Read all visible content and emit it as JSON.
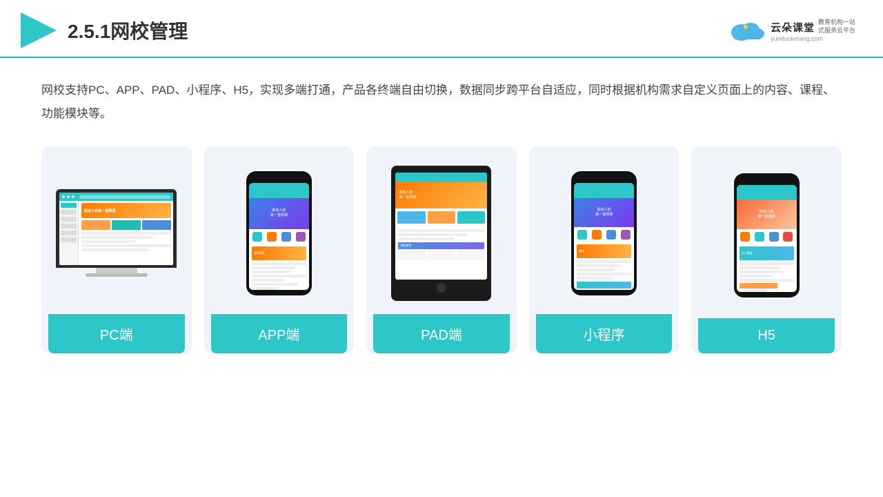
{
  "header": {
    "title": "2.5.1网校管理",
    "logo_name": "云朵课堂",
    "logo_url": "yunduoketang.com",
    "logo_tagline_line1": "教育机构一站",
    "logo_tagline_line2": "式服务云平台"
  },
  "description": {
    "text": "网校支持PC、APP、PAD、小程序、H5，实现多端打通，产品各终端自由切换，数据同步跨平台自适应，同时根据机构需求自定义页面上的内容、课程、功能模块等。"
  },
  "devices": [
    {
      "id": "pc",
      "label": "PC端",
      "type": "desktop"
    },
    {
      "id": "app",
      "label": "APP端",
      "type": "phone"
    },
    {
      "id": "pad",
      "label": "PAD端",
      "type": "tablet"
    },
    {
      "id": "miniprogram",
      "label": "小程序",
      "type": "phone"
    },
    {
      "id": "h5",
      "label": "H5",
      "type": "phone"
    }
  ],
  "colors": {
    "accent": "#2DC6C9",
    "orange": "#FF7A00",
    "brand_dark": "#1a8a8e"
  }
}
